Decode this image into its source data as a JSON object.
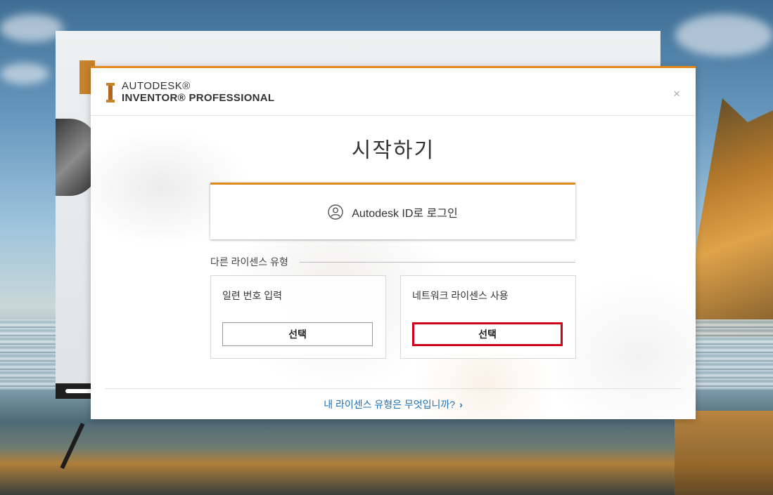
{
  "brand": {
    "line1": "AUTODESK®",
    "line2": "INVENTOR® PROFESSIONAL",
    "accent": "#e08a1e"
  },
  "dialog": {
    "close_glyph": "×",
    "title": "시작하기",
    "signin": {
      "icon": "user-icon",
      "label": "Autodesk ID로 로그인"
    },
    "other_license_label": "다른 라이센스 유형",
    "options": [
      {
        "label": "일련 번호 입력",
        "button": "선택"
      },
      {
        "label": "네트워크 라이센스 사용",
        "button": "선택"
      }
    ],
    "footer_link": "내 라이센스 유형은 무엇입니까?",
    "footer_icon": "chevron-right-icon"
  }
}
